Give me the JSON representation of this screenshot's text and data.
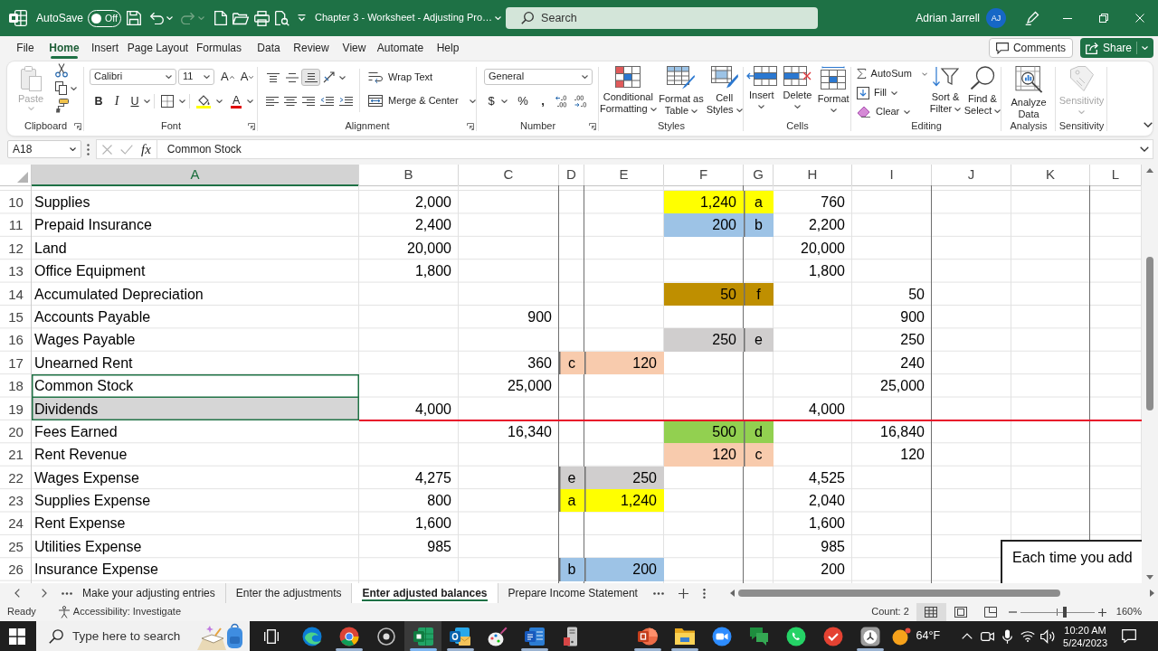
{
  "title_bar": {
    "autosave_label": "AutoSave",
    "autosave": {
      "label": "Off",
      "on": false
    },
    "redo": {
      "disabled": true
    },
    "document_title": "Chapter 3 - Worksheet - Adjusting Pro…",
    "search": {
      "placeholder": "Search"
    },
    "user_name": "Adrian Jarrell",
    "avatar_initials": "AJ"
  },
  "menu_tabs": [
    {
      "label": "File",
      "selected": false
    },
    {
      "label": "Home",
      "selected": true
    },
    {
      "label": "Insert",
      "selected": false
    },
    {
      "label": "Page Layout",
      "selected": false
    },
    {
      "label": "Formulas",
      "selected": false
    },
    {
      "label": "Data",
      "selected": false
    },
    {
      "label": "Review",
      "selected": false
    },
    {
      "label": "View",
      "selected": false
    },
    {
      "label": "Automate",
      "selected": false
    },
    {
      "label": "Help",
      "selected": false
    }
  ],
  "header_buttons": {
    "comments": "Comments",
    "share": "Share"
  },
  "ribbon": {
    "clipboard": {
      "label": "Clipboard",
      "paste": {
        "label": "Paste",
        "disabled": true
      }
    },
    "font": {
      "label": "Font",
      "font_name": "Calibri",
      "font_size": "11",
      "grow_font": "A",
      "shrink_font": "A",
      "bold": "B",
      "italic": "I",
      "underline": "U",
      "font_color": "A"
    },
    "alignment": {
      "label": "Alignment",
      "vertical_align": [
        {
          "selected": false
        },
        {
          "selected": false
        },
        {
          "selected": true
        }
      ],
      "wrap_text": "Wrap Text",
      "merge": "Merge & Center"
    },
    "number": {
      "label": "Number",
      "format": "General",
      "currency": "$",
      "percent": "%",
      "comma": ","
    },
    "styles": {
      "label": "Styles",
      "buttons": [
        "Conditional Formatting",
        "Format as Table",
        "Cell Styles"
      ]
    },
    "cells": {
      "label": "Cells",
      "buttons": [
        "Insert",
        "Delete",
        "Format"
      ]
    },
    "editing": {
      "label": "Editing",
      "autosum": "AutoSum",
      "fill": "Fill",
      "clear": "Clear",
      "sort_filter": "Sort & Filter",
      "find_select": "Find & Select"
    },
    "analysis": {
      "label": "Analysis",
      "analyze_data": "Analyze Data"
    },
    "sensitivity": {
      "label": "Sensitivity",
      "button": {
        "label": "Sensitivity",
        "disabled": true
      }
    }
  },
  "formula_bar": {
    "name_box": "A18",
    "function_label": "fx",
    "content": "Common Stock"
  },
  "sheet": {
    "columns": [
      {
        "label": "A",
        "selected": true
      },
      {
        "label": "B",
        "selected": false
      },
      {
        "label": "C",
        "selected": false
      },
      {
        "label": "D",
        "selected": false
      },
      {
        "label": "E",
        "selected": false
      },
      {
        "label": "F",
        "selected": false
      },
      {
        "label": "G",
        "selected": false
      },
      {
        "label": "H",
        "selected": false
      },
      {
        "label": "I",
        "selected": false
      },
      {
        "label": "J",
        "selected": false
      },
      {
        "label": "K",
        "selected": false
      },
      {
        "label": "L",
        "selected": false
      }
    ],
    "rows": [
      {
        "number": "10",
        "rule_below": false,
        "cells": {
          "a": {
            "text": "Supplies",
            "selected": false,
            "active": false
          },
          "b": {
            "text": "2,000"
          },
          "f": {
            "text": "1,240",
            "color": "#ffff00"
          },
          "g": {
            "text": "a",
            "color": "#ffff00"
          },
          "h": {
            "text": "760"
          }
        }
      },
      {
        "number": "11",
        "rule_below": false,
        "cells": {
          "a": {
            "text": "Prepaid Insurance",
            "selected": false,
            "active": false
          },
          "b": {
            "text": "2,400"
          },
          "f": {
            "text": "200",
            "color": "#9dc3e6"
          },
          "g": {
            "text": "b",
            "color": "#9dc3e6"
          },
          "h": {
            "text": "2,200"
          }
        }
      },
      {
        "number": "12",
        "rule_below": false,
        "cells": {
          "a": {
            "text": "Land",
            "selected": false,
            "active": false
          },
          "b": {
            "text": "20,000"
          },
          "h": {
            "text": "20,000"
          }
        }
      },
      {
        "number": "13",
        "rule_below": false,
        "cells": {
          "a": {
            "text": "Office Equipment",
            "selected": false,
            "active": false
          },
          "b": {
            "text": "1,800"
          },
          "h": {
            "text": "1,800"
          }
        }
      },
      {
        "number": "14",
        "rule_below": false,
        "cells": {
          "a": {
            "text": "Accumulated Depreciation",
            "selected": false,
            "active": false
          },
          "f": {
            "text": "50",
            "color": "#bf8f00"
          },
          "g": {
            "text": "f",
            "color": "#bf8f00"
          },
          "i": {
            "text": "50"
          }
        }
      },
      {
        "number": "15",
        "rule_below": false,
        "cells": {
          "a": {
            "text": "Accounts Payable",
            "selected": false,
            "active": false
          },
          "c": {
            "text": "900"
          },
          "i": {
            "text": "900"
          }
        }
      },
      {
        "number": "16",
        "rule_below": false,
        "cells": {
          "a": {
            "text": "Wages Payable",
            "selected": false,
            "active": false
          },
          "f": {
            "text": "250",
            "color": "#d0cece"
          },
          "g": {
            "text": "e",
            "color": "#d0cece"
          },
          "i": {
            "text": "250"
          }
        }
      },
      {
        "number": "17",
        "rule_below": false,
        "cells": {
          "a": {
            "text": "Unearned Rent",
            "selected": false,
            "active": false
          },
          "c": {
            "text": "360"
          },
          "d": {
            "text": "c",
            "color": "#f8cbad"
          },
          "e": {
            "text": "120",
            "color": "#f8cbad"
          },
          "i": {
            "text": "240"
          }
        }
      },
      {
        "number": "18",
        "rule_below": false,
        "cells": {
          "a": {
            "text": "Common Stock",
            "selected": true,
            "active": true
          },
          "c": {
            "text": "25,000"
          },
          "i": {
            "text": "25,000"
          }
        }
      },
      {
        "number": "19",
        "rule_below": true,
        "cells": {
          "a": {
            "text": "Dividends",
            "selected": true,
            "active": false
          },
          "b": {
            "text": "4,000"
          },
          "h": {
            "text": "4,000"
          }
        }
      },
      {
        "number": "20",
        "rule_below": false,
        "cells": {
          "a": {
            "text": "Fees Earned",
            "selected": false,
            "active": false
          },
          "c": {
            "text": "16,340"
          },
          "f": {
            "text": "500",
            "color": "#92d050"
          },
          "g": {
            "text": "d",
            "color": "#92d050"
          },
          "i": {
            "text": "16,840"
          }
        }
      },
      {
        "number": "21",
        "rule_below": false,
        "cells": {
          "a": {
            "text": "Rent Revenue",
            "selected": false,
            "active": false
          },
          "f": {
            "text": "120",
            "color": "#f8cbad"
          },
          "g": {
            "text": "c",
            "color": "#f8cbad"
          },
          "i": {
            "text": "120"
          }
        }
      },
      {
        "number": "22",
        "rule_below": false,
        "cells": {
          "a": {
            "text": "Wages Expense",
            "selected": false,
            "active": false
          },
          "b": {
            "text": "4,275"
          },
          "d": {
            "text": "e",
            "color": "#d0cece"
          },
          "e": {
            "text": "250",
            "color": "#d0cece"
          },
          "h": {
            "text": "4,525"
          }
        }
      },
      {
        "number": "23",
        "rule_below": false,
        "cells": {
          "a": {
            "text": "Supplies Expense",
            "selected": false,
            "active": false
          },
          "b": {
            "text": "800"
          },
          "d": {
            "text": "a",
            "color": "#ffff00"
          },
          "e": {
            "text": "1,240",
            "color": "#ffff00"
          },
          "h": {
            "text": "2,040"
          }
        }
      },
      {
        "number": "24",
        "rule_below": false,
        "cells": {
          "a": {
            "text": "Rent Expense",
            "selected": false,
            "active": false
          },
          "b": {
            "text": "1,600"
          },
          "h": {
            "text": "1,600"
          }
        }
      },
      {
        "number": "25",
        "rule_below": false,
        "cells": {
          "a": {
            "text": "Utilities Expense",
            "selected": false,
            "active": false
          },
          "b": {
            "text": "985"
          },
          "h": {
            "text": "985"
          }
        }
      },
      {
        "number": "26",
        "rule_below": false,
        "cells": {
          "a": {
            "text": "Insurance Expense",
            "selected": false,
            "active": false
          },
          "d": {
            "text": "b",
            "color": "#9dc3e6"
          },
          "e": {
            "text": "200",
            "color": "#9dc3e6"
          },
          "h": {
            "text": "200"
          }
        }
      }
    ],
    "text_box": "Each time you add"
  },
  "sheet_tabs": [
    {
      "label": "Make your adjusting entries",
      "selected": false
    },
    {
      "label": "Enter the adjustments",
      "selected": false
    },
    {
      "label": "Enter adjusted balances",
      "selected": true
    },
    {
      "label": "Prepare Income Statement",
      "selected": false
    }
  ],
  "status_bar": {
    "status": "Ready",
    "accessibility": "Accessibility: Investigate",
    "count": "Count: 2",
    "views": [
      {
        "selected": true
      },
      {
        "selected": false
      },
      {
        "selected": false
      }
    ],
    "zoom": {
      "level": 0.6,
      "reading": "160%"
    }
  },
  "taskbar": {
    "search_placeholder": "Type here to search",
    "apps": [
      {
        "running": false,
        "selected": false
      },
      {
        "running": true,
        "selected": false
      },
      {
        "running": false,
        "selected": false
      },
      {
        "running": true,
        "selected": true
      },
      {
        "running": true,
        "selected": false
      },
      {
        "running": false,
        "selected": false
      },
      {
        "running": true,
        "selected": false
      },
      {
        "running": false,
        "selected": false
      },
      {
        "running": true,
        "selected": false
      },
      {
        "running": true,
        "selected": false
      },
      {
        "running": false,
        "selected": false
      },
      {
        "running": false,
        "selected": false
      },
      {
        "running": false,
        "selected": false
      },
      {
        "running": false,
        "selected": false
      },
      {
        "running": true,
        "selected": false
      }
    ],
    "weather": "64°F",
    "time": "10:20 AM",
    "date": "5/24/2023"
  }
}
